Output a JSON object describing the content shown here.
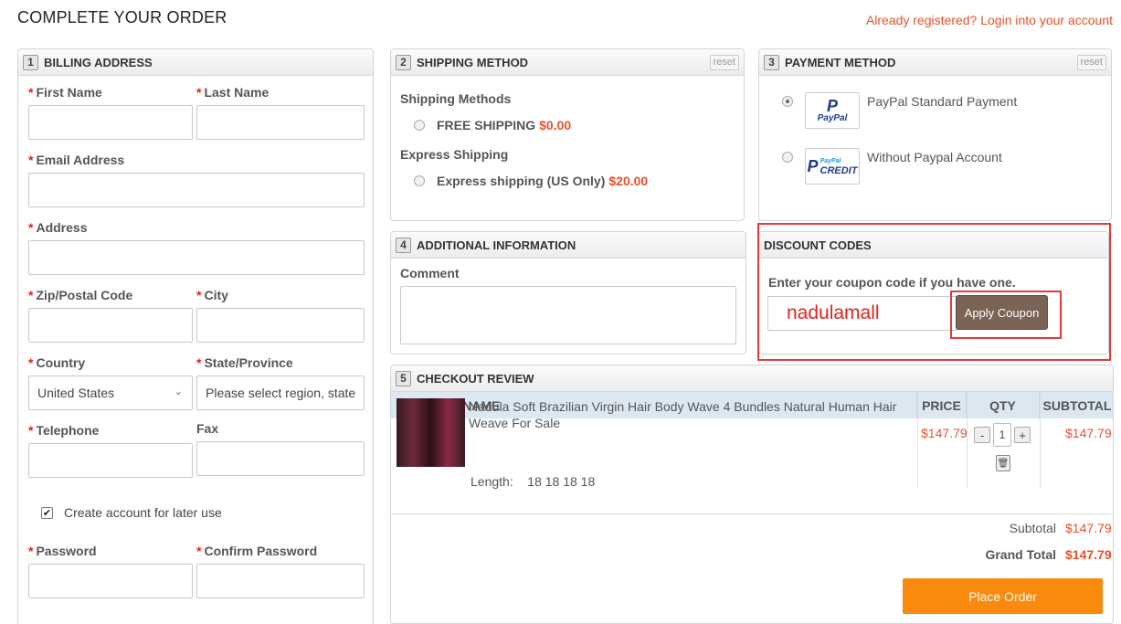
{
  "header": {
    "title": "COMPLETE YOUR ORDER",
    "login_link": "Already registered? Login into your account"
  },
  "billing": {
    "step": "1",
    "title": "BILLING ADDRESS",
    "required_mark": "*",
    "first_name_label": "First Name",
    "last_name_label": "Last Name",
    "email_label": "Email Address",
    "address_label": "Address",
    "zip_label": "Zip/Postal Code",
    "city_label": "City",
    "country_label": "Country",
    "country_value": "United States",
    "state_label": "State/Province",
    "state_placeholder": "Please select region, state",
    "telephone_label": "Telephone",
    "fax_label": "Fax",
    "create_account_label": "Create account for later use",
    "check_mark": "✔",
    "password_label": "Password",
    "confirm_password_label": "Confirm Password"
  },
  "shipping": {
    "step": "2",
    "title": "SHIPPING METHOD",
    "reset_label": "reset",
    "group1_title": "Shipping Methods",
    "option1_label": "FREE SHIPPING",
    "option1_price": "$0.00",
    "group2_title": "Express Shipping",
    "option2_label": "Express shipping (US Only)",
    "option2_price": "$20.00"
  },
  "payment": {
    "step": "3",
    "title": "PAYMENT METHOD",
    "reset_label": "reset",
    "option1_label": "PayPal Standard Payment",
    "option1_logo_text": "PayPal",
    "option2_label": "Without Paypal Account",
    "option2_logo_small": "PayPal",
    "option2_logo_text": "CREDIT"
  },
  "additional": {
    "step": "4",
    "title": "ADDITIONAL INFORMATION",
    "comment_label": "Comment"
  },
  "discount": {
    "title": "DISCOUNT CODES",
    "hint": "Enter your coupon code if you have one.",
    "coupon_value": "nadulamall",
    "apply_label": "Apply Coupon"
  },
  "review": {
    "step": "5",
    "title": "CHECKOUT REVIEW",
    "col_product": "PRODUCT NAME",
    "col_price": "PRICE",
    "col_qty": "QTY",
    "col_subtotal": "SUBTOTAL",
    "product_name": "Nadula Soft Brazilian Virgin Hair Body Wave 4 Bundles Natural Human Hair Weave For Sale",
    "length_label": "Length:",
    "length_value": "18 18 18 18",
    "price": "$147.79",
    "qty": "1",
    "qty_minus": "-",
    "qty_plus": "+",
    "trash_glyph": "🗑",
    "line_subtotal": "$147.79",
    "subtotal_label": "Subtotal",
    "subtotal_value": "$147.79",
    "grand_total_label": "Grand Total",
    "grand_total_value": "$147.79",
    "place_order_label": "Place Order"
  }
}
